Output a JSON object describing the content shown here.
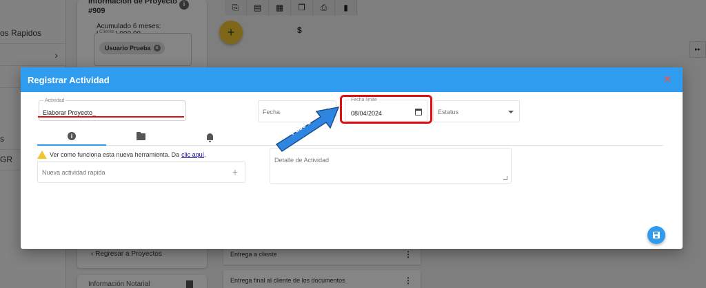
{
  "background": {
    "sidebar": {
      "items": [
        {
          "label": "os Rapidos",
          "chevron": false
        },
        {
          "label": "",
          "chevron": true
        },
        {
          "label": "",
          "chevron": false
        },
        {
          "label": "s",
          "chevron": false
        },
        {
          "label": "GR",
          "chevron": false
        }
      ]
    },
    "project": {
      "title": "Información de Proyecto",
      "number": "#909",
      "accumulated": "Acumulado 6 meses: $1,050,000.00",
      "client_legend": "Cliente",
      "client_chip": "Usuario Prueba",
      "back_link": "Regresar a Proyectos",
      "notarial": "Información Notarial"
    },
    "toolbar_icons": [
      "clipboard-icon",
      "document-icon",
      "table-icon",
      "copy-icon",
      "print-icon",
      "file-icon"
    ],
    "add_symbol": "+",
    "currency_symbol": "$",
    "fast_forward": "▸▸",
    "list_items": [
      {
        "label": "Entrega a cliente",
        "menu": "⋮"
      },
      {
        "label": "Entrega final al cliente de los documentos",
        "menu": "⋮"
      }
    ]
  },
  "modal": {
    "title": "Registrar Actividad",
    "close_symbol": "✕",
    "actividad": {
      "legend": "Actividad",
      "value": "Elaborar Proyecto_"
    },
    "fecha": {
      "placeholder": "Fecha"
    },
    "fecha_limite": {
      "legend": "Fecha limite",
      "value": "08/04/2024"
    },
    "estatus": {
      "placeholder": "Estatus"
    },
    "tabs": [
      {
        "icon": "info-icon",
        "symbol": "i"
      },
      {
        "icon": "folder-icon"
      },
      {
        "icon": "bell-icon"
      }
    ],
    "warning": {
      "text": "Ver como funciona esta nueva herramienta. Da",
      "link": "clic aquí",
      "after": "."
    },
    "quick_activity": {
      "placeholder": "Nueva actividad rapida",
      "plus": "+"
    },
    "detalle": {
      "placeholder": "Detalle de Actividad"
    }
  },
  "annotation": {
    "label": "Paso 6"
  },
  "colors": {
    "header_blue": "#2f9cf0",
    "highlight_red": "#e01010",
    "fab_yellow": "#f2c530"
  }
}
